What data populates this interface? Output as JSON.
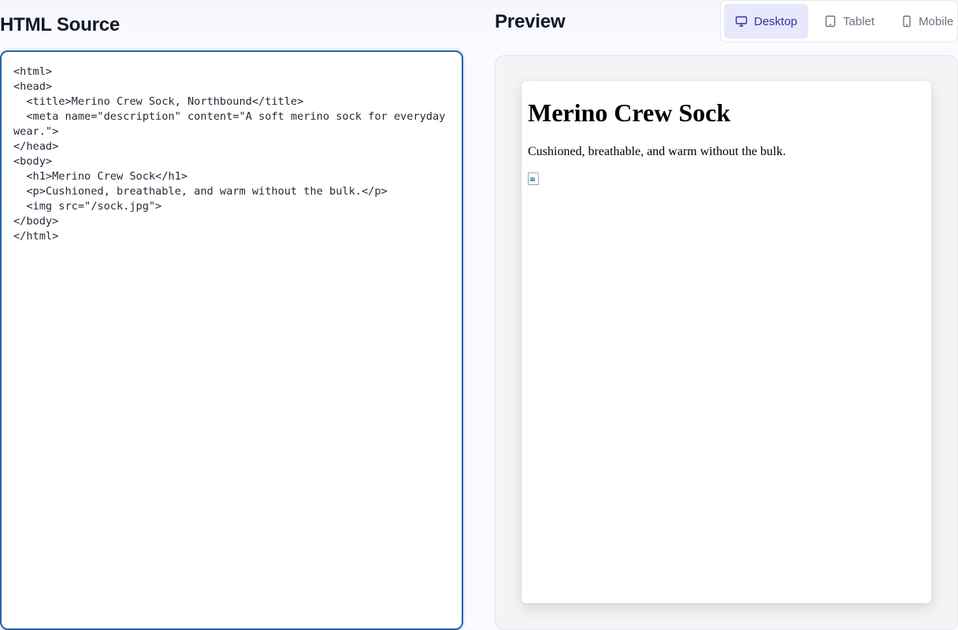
{
  "editor": {
    "title": "HTML Source",
    "source": "<html>\n<head>\n  <title>Merino Crew Sock, Northbound</title>\n  <meta name=\"description\" content=\"A soft merino sock for everyday wear.\">\n</head>\n<body>\n  <h1>Merino Crew Sock</h1>\n  <p>Cushioned, breathable, and warm without the bulk.</p>\n  <img src=\"/sock.jpg\">\n</body>\n</html>"
  },
  "preview": {
    "title": "Preview",
    "devices": [
      {
        "label": "Desktop",
        "icon": "monitor-icon",
        "active": true
      },
      {
        "label": "Tablet",
        "icon": "tablet-icon",
        "active": false
      },
      {
        "label": "Mobile",
        "icon": "phone-icon",
        "active": false
      }
    ],
    "rendered": {
      "heading": "Merino Crew Sock",
      "paragraph": "Cushioned, breathable, and warm without the bulk.",
      "image_icon": "broken-image-icon"
    }
  },
  "colors": {
    "accent": "#2563a8",
    "active_tab_bg": "#e7e8fb",
    "active_tab_text": "#3730a3"
  }
}
